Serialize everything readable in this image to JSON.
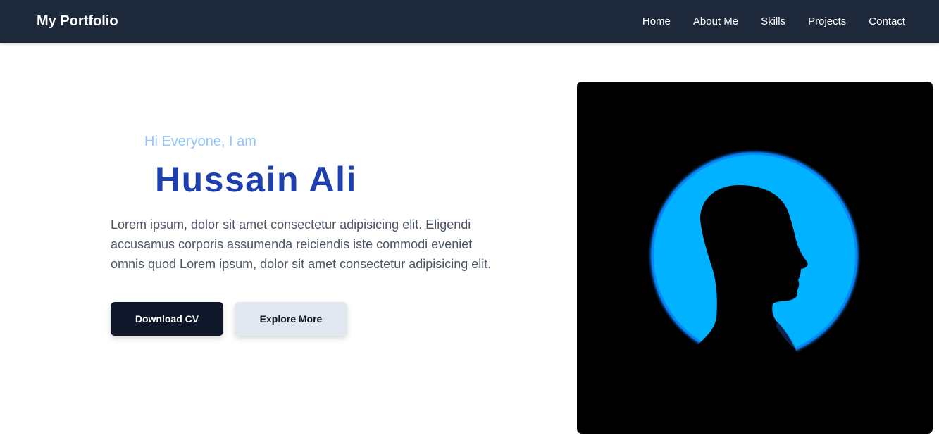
{
  "nav": {
    "brand": "My Portfolio",
    "links": [
      "Home",
      "About Me",
      "Skills",
      "Projects",
      "Contact"
    ]
  },
  "hero": {
    "greeting": "Hi Everyone, I am",
    "name": "Hussain Ali",
    "bio": "Lorem ipsum, dolor sit amet consectetur adipisicing elit. Eligendi accusamus corporis assumenda reiciendis iste commodi eveniet omnis quod Lorem ipsum, dolor sit amet consectetur adipisicing elit.",
    "primary_button": "Download CV",
    "secondary_button": "Explore More"
  },
  "colors": {
    "navbar": "#1e293b",
    "name": "#1e40af",
    "greeting": "#93c5fd",
    "glow": "#00b2ff"
  },
  "image": {
    "icon": "person-silhouette-icon"
  }
}
